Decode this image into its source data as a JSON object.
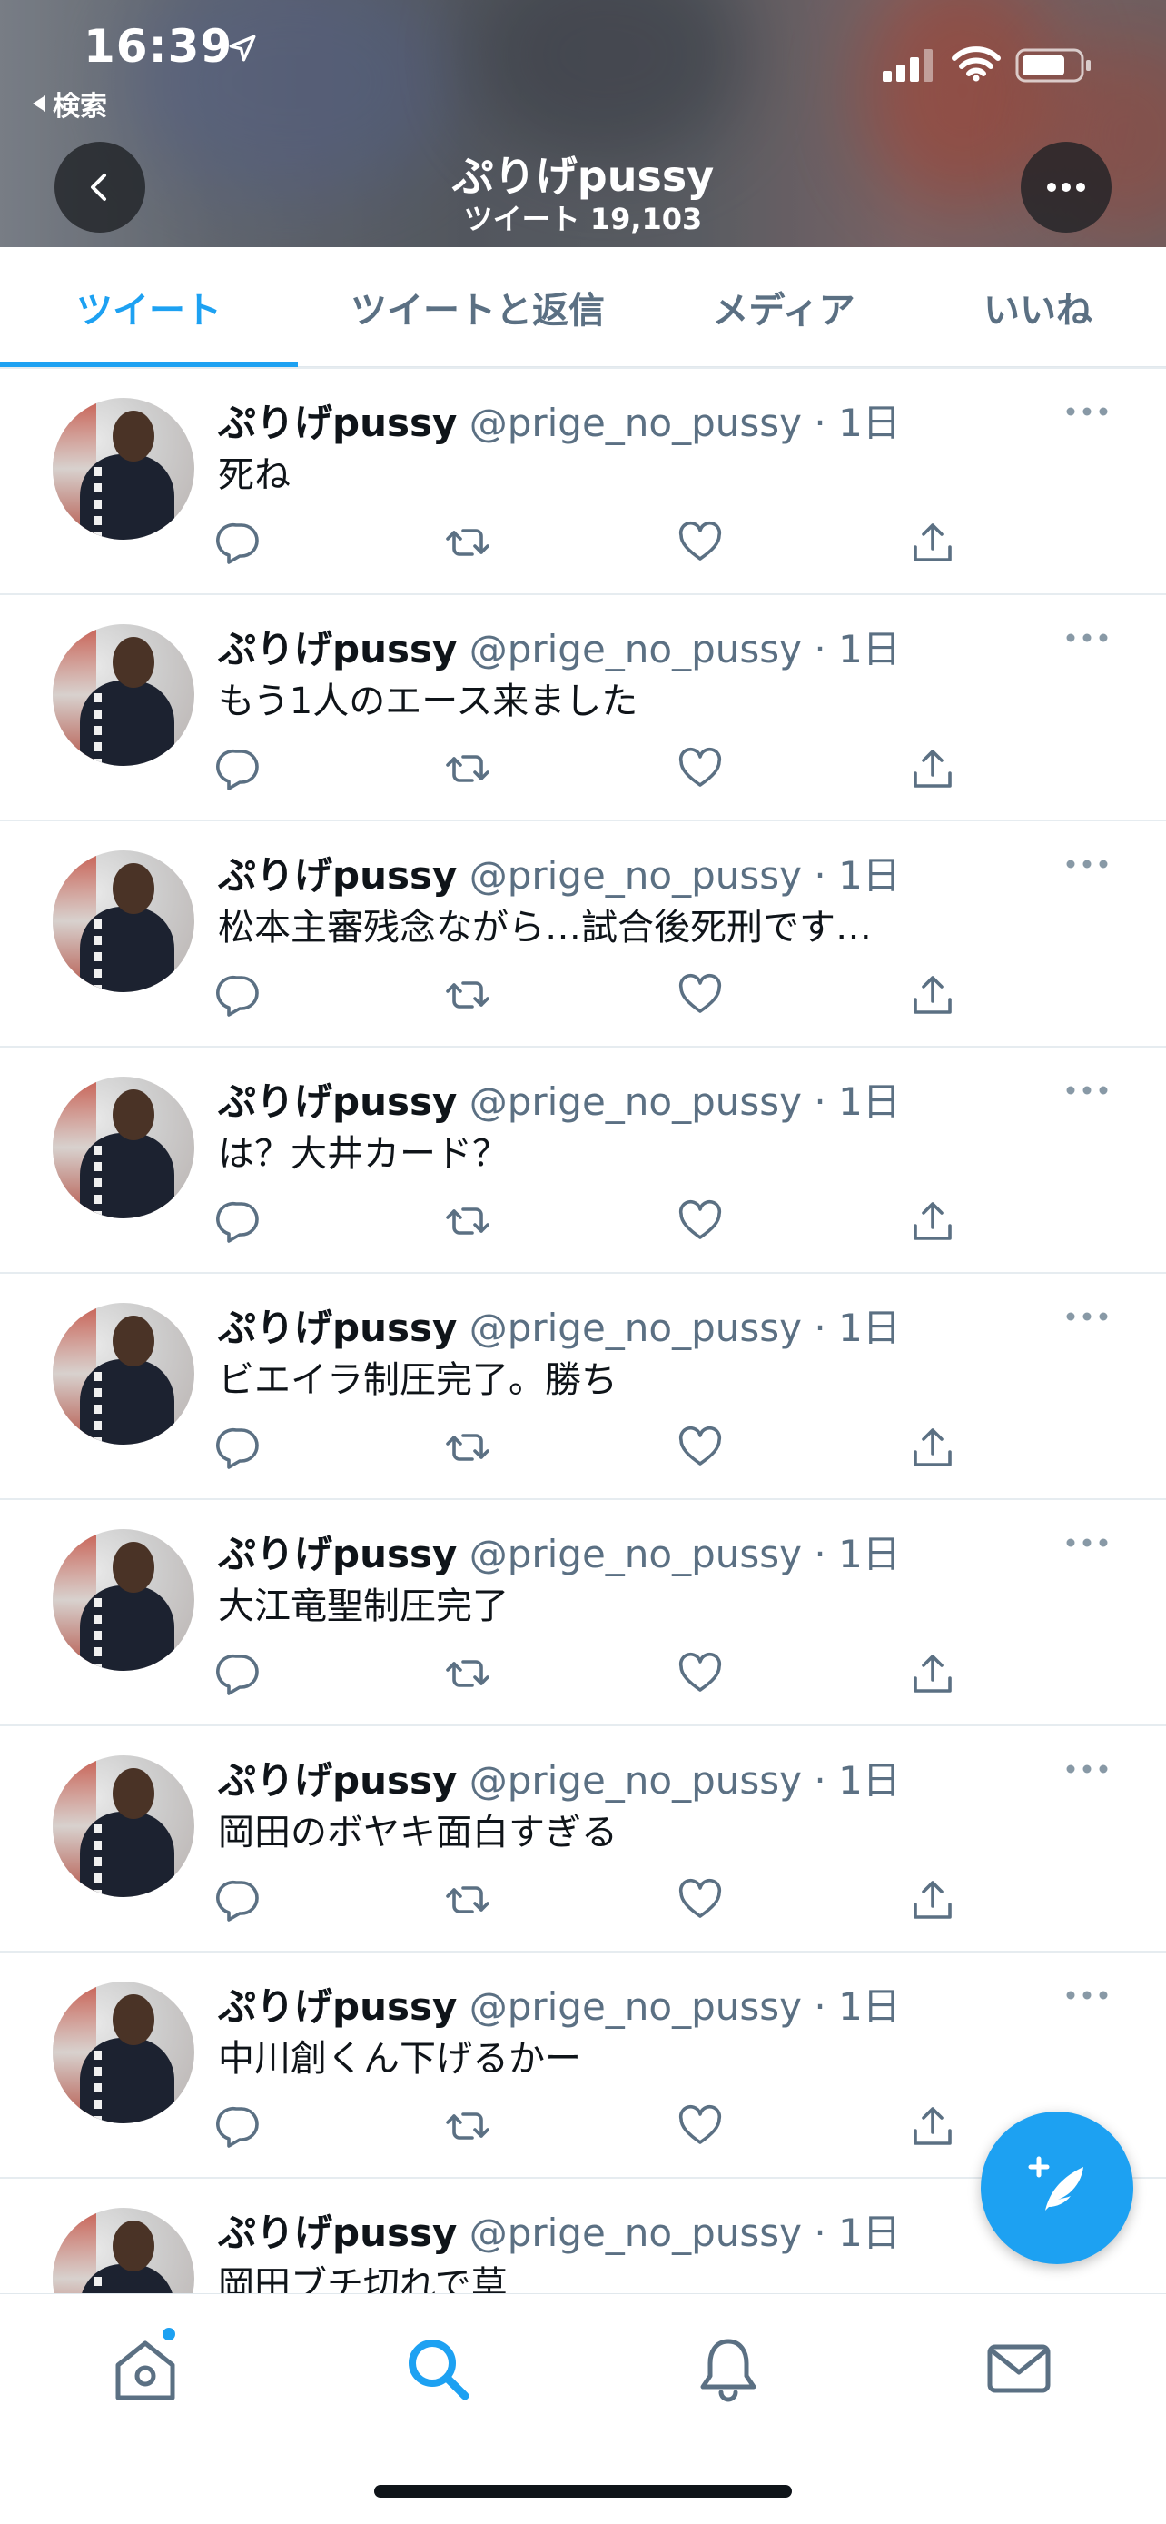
{
  "status_bar": {
    "time": "16:39",
    "back_to_app": "検索"
  },
  "header": {
    "profile_name": "ぷりげpussy",
    "tweet_count": "ツイート 19,103"
  },
  "tabs": [
    {
      "label": "ツイート",
      "active": true
    },
    {
      "label": "ツイートと返信",
      "active": false
    },
    {
      "label": "メディア",
      "active": false
    },
    {
      "label": "いいね",
      "active": false
    }
  ],
  "tweets": [
    {
      "name": "ぷりげpussy",
      "handle": "@prige_no_pussy",
      "time": "1日",
      "text": "死ね"
    },
    {
      "name": "ぷりげpussy",
      "handle": "@prige_no_pussy",
      "time": "1日",
      "text": "もう1人のエース来ました"
    },
    {
      "name": "ぷりげpussy",
      "handle": "@prige_no_pussy",
      "time": "1日",
      "text": "松本主審残念ながら…試合後死刑です…"
    },
    {
      "name": "ぷりげpussy",
      "handle": "@prige_no_pussy",
      "time": "1日",
      "text": "は？大井カード？"
    },
    {
      "name": "ぷりげpussy",
      "handle": "@prige_no_pussy",
      "time": "1日",
      "text": "ビエイラ制圧完了。勝ち"
    },
    {
      "name": "ぷりげpussy",
      "handle": "@prige_no_pussy",
      "time": "1日",
      "text": "大江竜聖制圧完了"
    },
    {
      "name": "ぷりげpussy",
      "handle": "@prige_no_pussy",
      "time": "1日",
      "text": "岡田のボヤキ面白すぎる"
    },
    {
      "name": "ぷりげpussy",
      "handle": "@prige_no_pussy",
      "time": "1日",
      "text": "中川創くん下げるかー"
    },
    {
      "name": "ぷりげpussy",
      "handle": "@prige_no_pussy",
      "time": "1日",
      "text": "岡田ブチ切れで草"
    }
  ],
  "icons": {
    "reply": "reply-icon",
    "retweet": "retweet-icon",
    "like": "heart-icon",
    "share": "share-icon",
    "compose": "compose-tweet-icon",
    "home": "home-icon",
    "search": "search-icon",
    "notifications": "bell-icon",
    "messages": "mail-icon"
  },
  "colors": {
    "accent": "#1da1f2",
    "text": "#0f1419",
    "secondary": "#5b7083"
  }
}
